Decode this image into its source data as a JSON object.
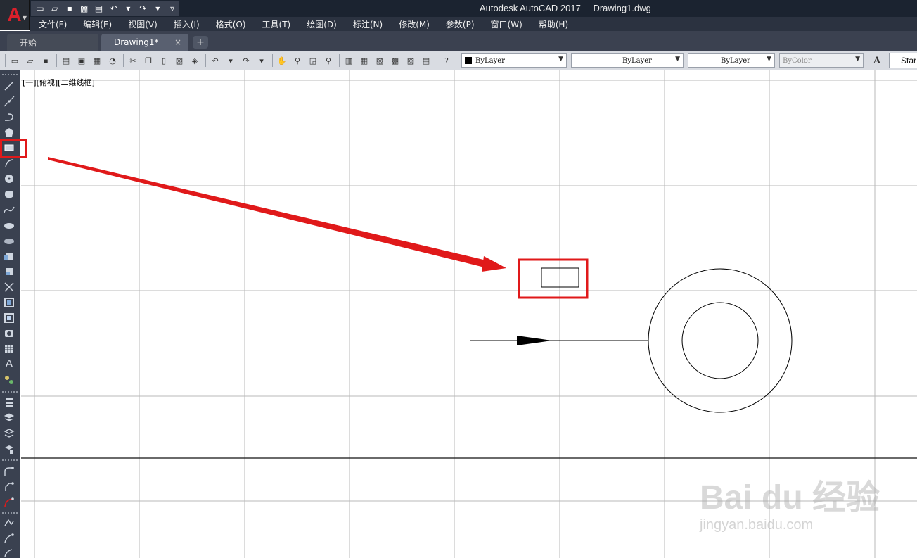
{
  "app": {
    "window_title": "Autodesk AutoCAD 2017",
    "file_name": "Drawing1.dwg",
    "logo_letter": "A"
  },
  "menu": {
    "items": [
      "文件(F)",
      "编辑(E)",
      "视图(V)",
      "插入(I)",
      "格式(O)",
      "工具(T)",
      "绘图(D)",
      "标注(N)",
      "修改(M)",
      "参数(P)",
      "窗口(W)",
      "帮助(H)"
    ]
  },
  "tabs": {
    "start_label": "开始",
    "drawing_label": "Drawing1*",
    "close_glyph": "×",
    "add_glyph": "+"
  },
  "properties": {
    "color": "ByLayer",
    "linetype": "ByLayer",
    "lineweight": "ByLayer",
    "plotstyle": "ByColor",
    "text_style_button": "Star"
  },
  "viewport": {
    "label": "[一][俯视][二维线框]"
  },
  "icons": {
    "left_toolbar": [
      "line-icon",
      "construction-line-icon",
      "polyline-icon",
      "polygon-icon",
      "rectangle-icon",
      "arc-icon",
      "circle-icon",
      "revision-cloud-icon",
      "spline-icon",
      "ellipse-icon",
      "ellipse-arc-icon",
      "insert-block-icon",
      "make-block-icon",
      "point-icon",
      "hatch-icon",
      "gradient-icon",
      "region-icon",
      "table-icon",
      "multiline-text-icon",
      "add-selected-icon"
    ]
  },
  "colors": {
    "annotation_red": "#e0191a",
    "title_bar": "#1b2330",
    "menu_bar": "#2b3240",
    "toolbar": "#d9dce2"
  },
  "watermark": {
    "brand": "Bai du 经验",
    "url": "jingyan.baidu.com"
  }
}
